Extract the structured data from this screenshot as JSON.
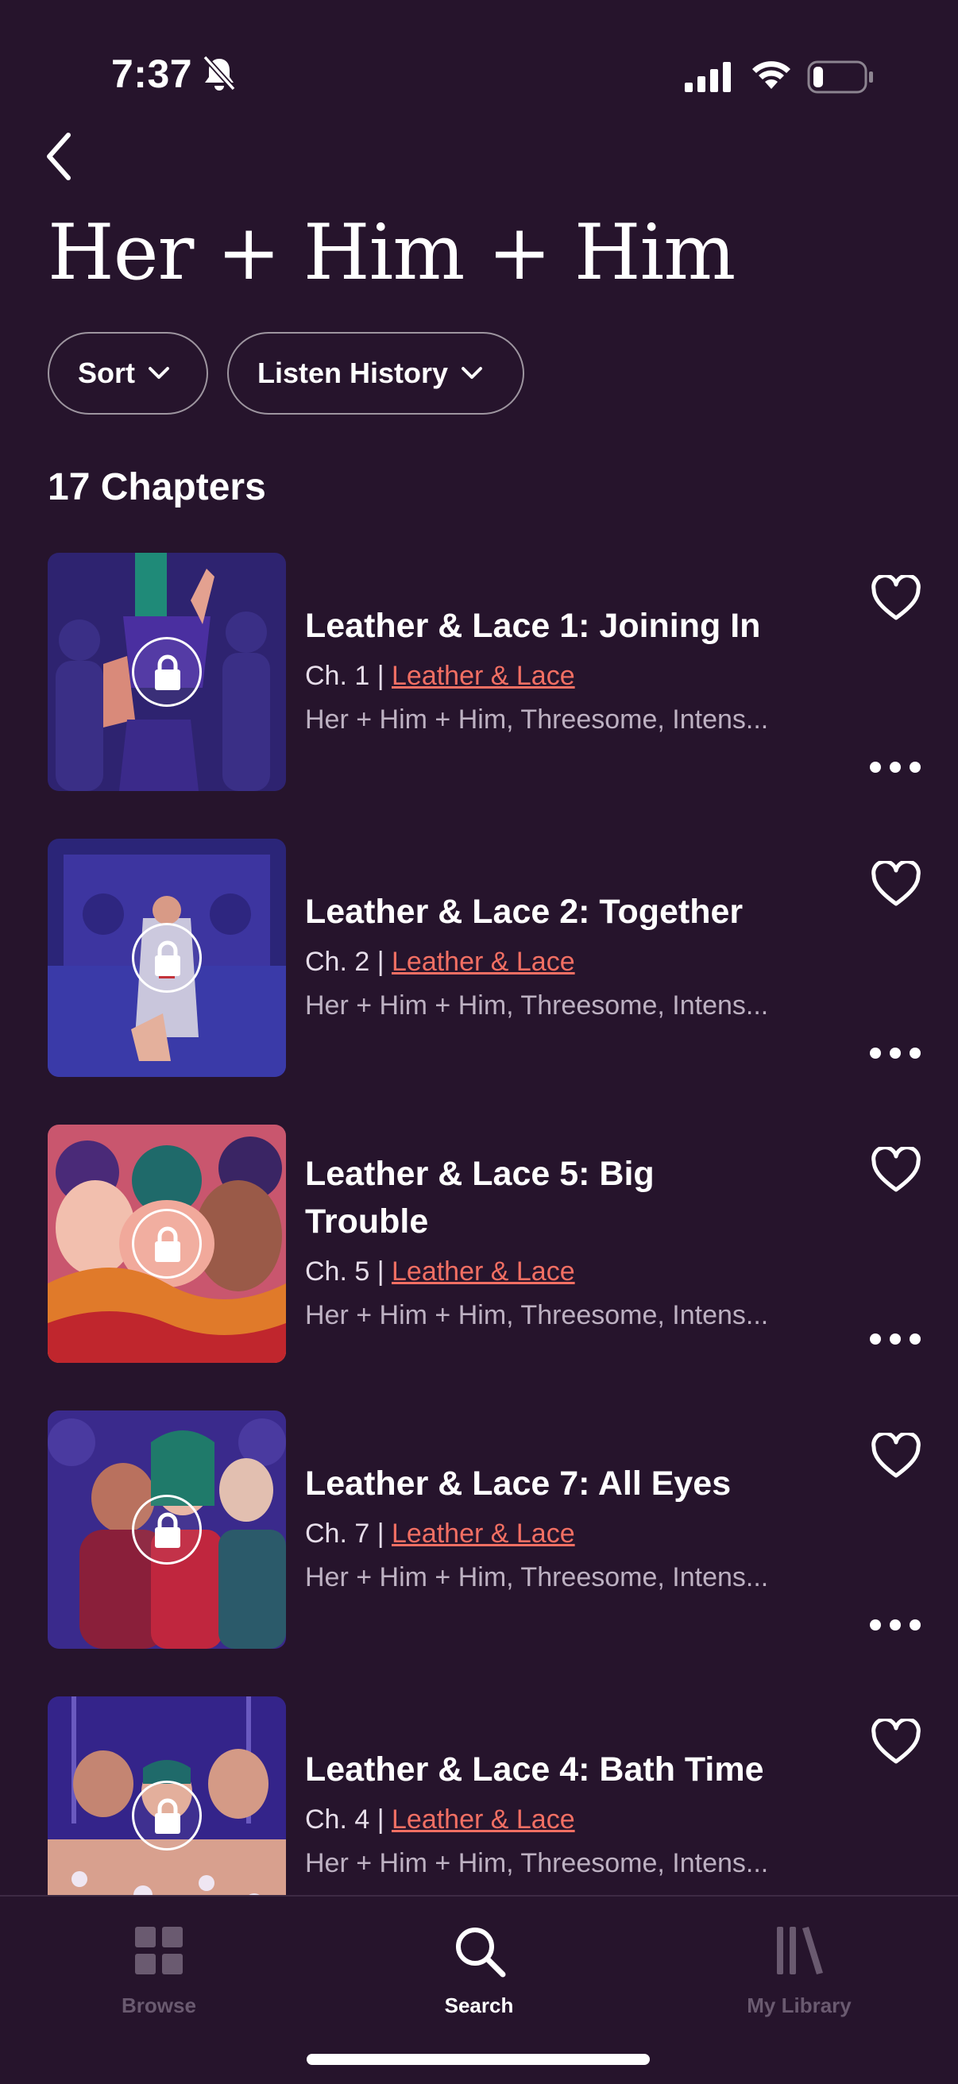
{
  "status_bar": {
    "time": "7:37"
  },
  "header": {
    "title": "Her + Him + Him"
  },
  "filters": {
    "sort_label": "Sort",
    "history_label": "Listen History"
  },
  "chapter_count": "17 Chapters",
  "colors": {
    "background": "#26142c",
    "link": "#f26f63",
    "tag_text": "#bdb1c2"
  },
  "chapters": [
    {
      "title": "Leather & Lace 1: Joining In",
      "chapter": "Ch. 1 |",
      "series": "Leather & Lace",
      "tags": "Her + Him + Him, Threesome, Intens..."
    },
    {
      "title": "Leather & Lace 2: Together",
      "chapter": "Ch. 2 |",
      "series": "Leather & Lace",
      "tags": "Her + Him + Him, Threesome, Intens..."
    },
    {
      "title": "Leather & Lace 5: Big Trouble",
      "chapter": "Ch. 5 |",
      "series": "Leather & Lace",
      "tags": "Her + Him + Him, Threesome, Intens..."
    },
    {
      "title": "Leather & Lace 7: All Eyes",
      "chapter": "Ch. 7 |",
      "series": "Leather & Lace",
      "tags": "Her + Him + Him, Threesome, Intens..."
    },
    {
      "title": "Leather & Lace 4: Bath Time",
      "chapter": "Ch. 4 |",
      "series": "Leather & Lace",
      "tags": "Her + Him + Him, Threesome, Intens..."
    }
  ],
  "tabs": [
    {
      "label": "Browse",
      "icon": "grid-icon",
      "active": false
    },
    {
      "label": "Search",
      "icon": "search-icon",
      "active": true
    },
    {
      "label": "My Library",
      "icon": "library-icon",
      "active": false
    }
  ]
}
